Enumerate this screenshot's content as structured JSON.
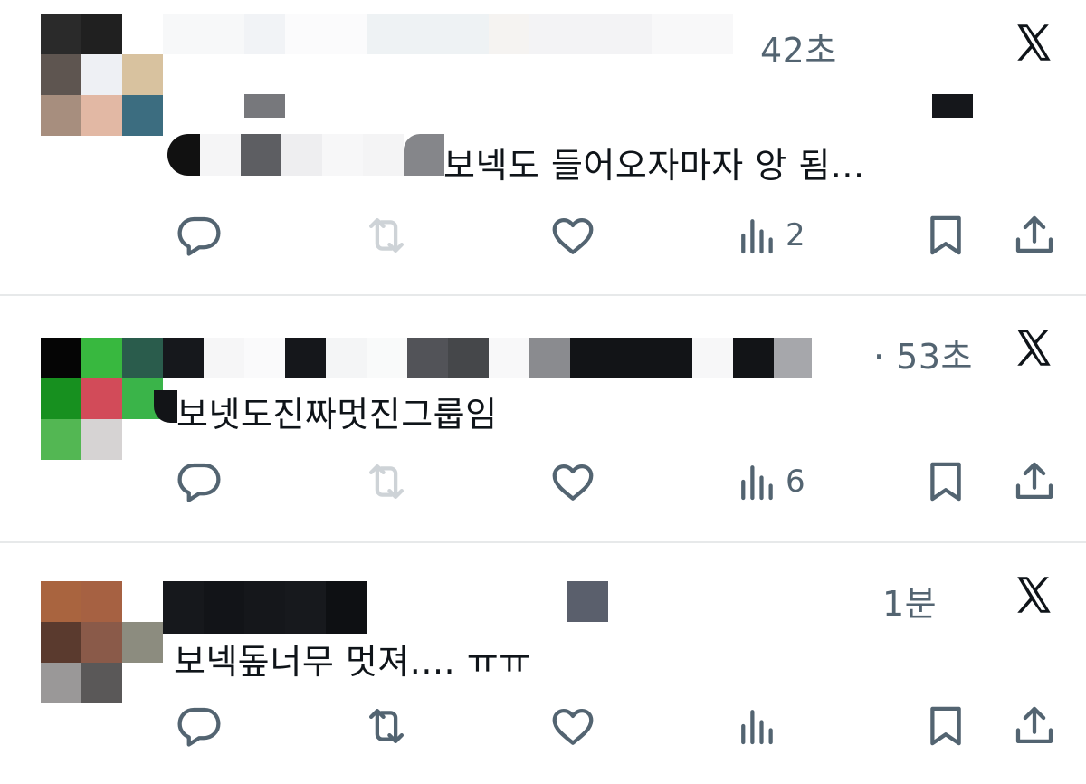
{
  "colors": {
    "icon": "#536471",
    "text": "#0f1419",
    "divider": "#e7e9ea"
  },
  "posts": [
    {
      "timestamp": "42초",
      "text": "보넥도 들어오자마자 앙 됨...",
      "views": "2",
      "retweet_disabled": true,
      "icons": [
        "reply-icon",
        "retweet-icon",
        "like-icon",
        "views-icon",
        "bookmark-icon",
        "share-icon",
        "x-logo-icon"
      ]
    },
    {
      "timestamp": "· 53초",
      "text": "보넷도진짜멋진그룹임",
      "views": "6",
      "retweet_disabled": true
    },
    {
      "timestamp": "1분",
      "text": "보넥돞너무 멋져.... ㅠㅠ",
      "views": "",
      "retweet_disabled": false
    }
  ]
}
